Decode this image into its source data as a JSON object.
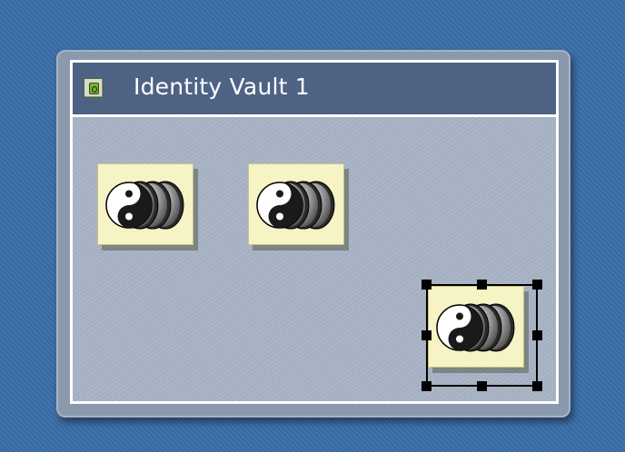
{
  "window": {
    "title": "Identity Vault 1",
    "title_icon": "vault-lock-icon"
  },
  "drivers": [
    {
      "icon": "yin-yang-stack-icon",
      "selected": false
    },
    {
      "icon": "yin-yang-stack-icon",
      "selected": false
    },
    {
      "icon": "yin-yang-stack-icon",
      "selected": true
    }
  ],
  "colors": {
    "desktop": "#3a6ea8",
    "frame": "#8a99ad",
    "titlebar": "#4e6384",
    "tile": "#f6f3c4"
  }
}
